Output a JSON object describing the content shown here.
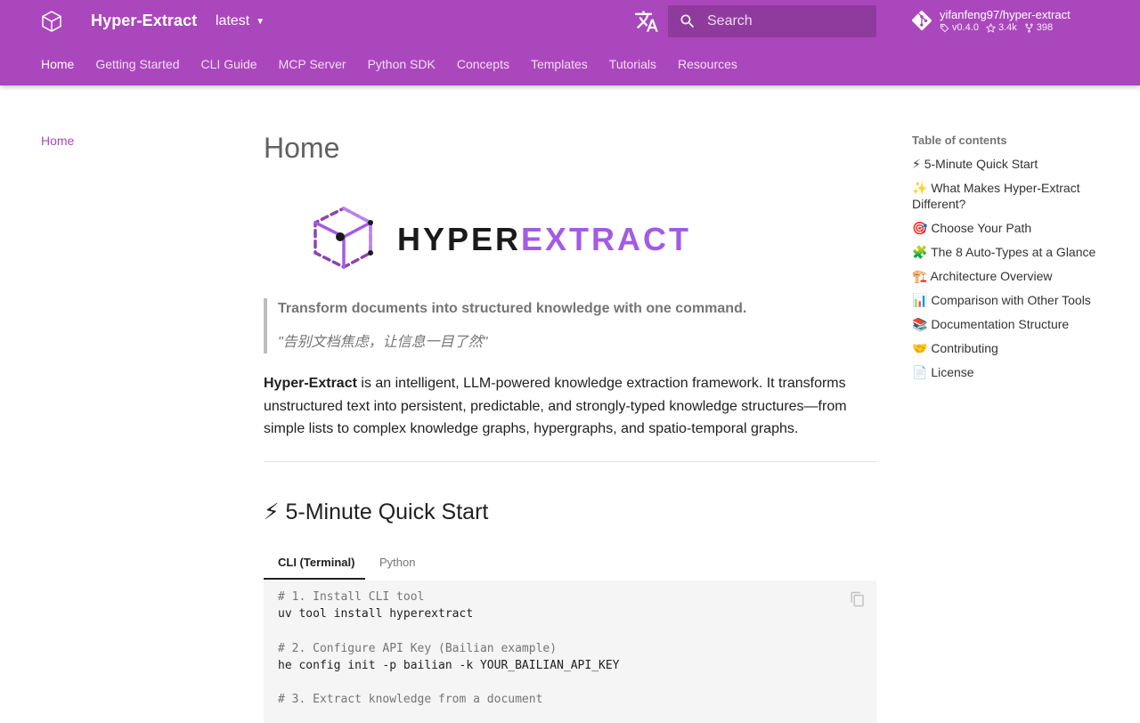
{
  "header": {
    "site_title": "Hyper-Extract",
    "version": "latest",
    "search_placeholder": "Search",
    "repo": {
      "name": "yifanfeng97/hyper-extract",
      "version": "v0.4.0",
      "stars": "3.4k",
      "forks": "398"
    },
    "tabs": [
      {
        "label": "Home"
      },
      {
        "label": "Getting Started"
      },
      {
        "label": "CLI Guide"
      },
      {
        "label": "MCP Server"
      },
      {
        "label": "Python SDK"
      },
      {
        "label": "Concepts"
      },
      {
        "label": "Templates"
      },
      {
        "label": "Tutorials"
      },
      {
        "label": "Resources"
      }
    ]
  },
  "left_nav": {
    "active_item": "Home"
  },
  "content": {
    "page_title": "Home",
    "brand": {
      "part1": "HYPER",
      "part2": "EXTRACT"
    },
    "quote_line1": "Transform documents into structured knowledge with one command.",
    "quote_line2": "\"告别文档焦虑，让信息一目了然\"",
    "intro_bold": "Hyper-Extract",
    "intro_rest": " is an intelligent, LLM-powered knowledge extraction framework. It transforms unstructured text into persistent, predictable, and strongly-typed knowledge structures—from simple lists to complex knowledge graphs, hypergraphs, and spatio-temporal graphs.",
    "section_title": "⚡ 5-Minute Quick Start",
    "code_tabs": [
      {
        "label": "CLI (Terminal)"
      },
      {
        "label": "Python"
      }
    ],
    "code_lines": [
      {
        "text": "# 1. Install CLI tool"
      },
      {
        "text": "uv tool install hyperextract"
      },
      {
        "text": "# 2. Configure API Key (Bailian example)"
      },
      {
        "text": "he config init -p bailian -k YOUR_BAILIAN_API_KEY"
      },
      {
        "text": "# 3. Extract knowledge from a document"
      }
    ]
  },
  "toc": {
    "title": "Table of contents",
    "items": [
      {
        "label": "⚡ 5-Minute Quick Start"
      },
      {
        "label": "✨ What Makes Hyper-Extract Different?"
      },
      {
        "label": "🎯 Choose Your Path"
      },
      {
        "label": "🧩 The 8 Auto-Types at a Glance"
      },
      {
        "label": "🏗️ Architecture Overview"
      },
      {
        "label": "📊 Comparison with Other Tools"
      },
      {
        "label": "📚 Documentation Structure"
      },
      {
        "label": "🤝 Contributing"
      },
      {
        "label": "📄 License"
      }
    ]
  },
  "colors": {
    "primary": "#ab47bc",
    "accent": "#a35be6",
    "text": "#212121",
    "muted": "#757575"
  }
}
